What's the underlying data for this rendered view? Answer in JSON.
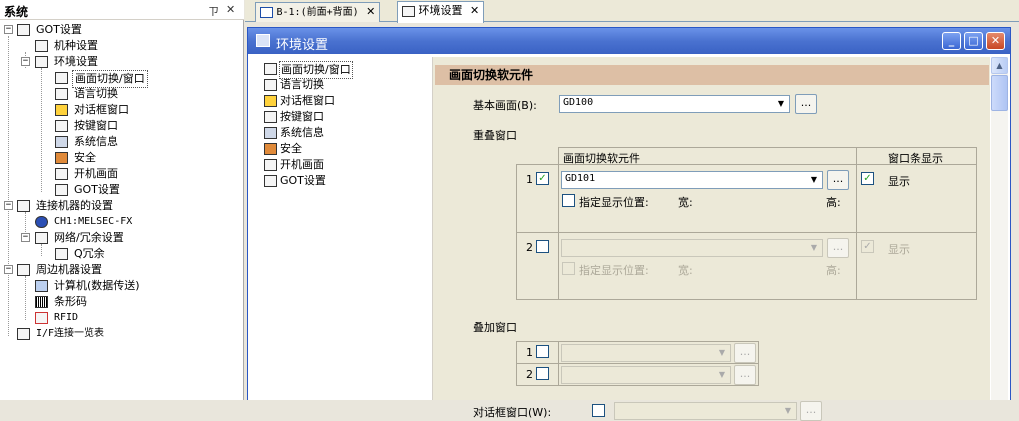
{
  "tree": {
    "title": "系统",
    "pin": "ㄗ",
    "close": "✕",
    "items": [
      {
        "label": "GOT设置",
        "expander": "−"
      },
      {
        "label": "机种设置"
      },
      {
        "label": "环境设置",
        "expander": "−"
      },
      {
        "label": "画面切换/窗口"
      },
      {
        "label": "语言切换"
      },
      {
        "label": "对话框窗口"
      },
      {
        "label": "按键窗口"
      },
      {
        "label": "系统信息"
      },
      {
        "label": "安全"
      },
      {
        "label": "开机画面"
      },
      {
        "label": "GOT设置"
      },
      {
        "label": "连接机器的设置",
        "expander": "−"
      },
      {
        "label": "CH1:MELSEC-FX"
      },
      {
        "label": "网络/冗余设置",
        "expander": "−"
      },
      {
        "label": "Q冗余"
      },
      {
        "label": "周边机器设置",
        "expander": "−"
      },
      {
        "label": "计算机(数据传送)"
      },
      {
        "label": "条形码"
      },
      {
        "label": "RFID"
      },
      {
        "label": "I/F连接一览表"
      }
    ]
  },
  "tabs": [
    {
      "label": "B-1:(前面+背面)",
      "close": "✕"
    },
    {
      "label": "环境设置",
      "close": "✕"
    }
  ],
  "window": {
    "title": "环境设置",
    "buttons": {
      "minimize": "_",
      "maximize": "□",
      "close": "✕"
    }
  },
  "inner_tree": [
    "画面切换/窗口",
    "语言切换",
    "对话框窗口",
    "按键窗口",
    "系统信息",
    "安全",
    "开机画面",
    "GOT设置"
  ],
  "settings": {
    "section_title": "画面切换软元件",
    "base_screen_label": "基本画面(B):",
    "base_screen_value": "GD100",
    "overlap_label": "重叠窗口",
    "col_device": "画面切换软元件",
    "col_titlebar": "窗口条显示",
    "rows": [
      {
        "num": "1",
        "checked": "✓",
        "device": "GD101",
        "show_checked": "✓",
        "show": "显示",
        "pos_label": "指定显示位置:",
        "width": "宽:",
        "height": "高:"
      },
      {
        "num": "2",
        "checked": "",
        "device": "",
        "show_checked": "✓",
        "show": "显示",
        "pos_label": "指定显示位置:",
        "width": "宽:",
        "height": "高:"
      }
    ],
    "superimpose_label": "叠加窗口",
    "super_rows": [
      "1",
      "2"
    ],
    "dialog_label": "对话框窗口(W):",
    "dots": "...",
    "arrow": "▼"
  },
  "colors": {
    "section_header": "#ddbfa5",
    "title_bar": "#4a72d0",
    "panel_bg": "#ece9d8"
  }
}
